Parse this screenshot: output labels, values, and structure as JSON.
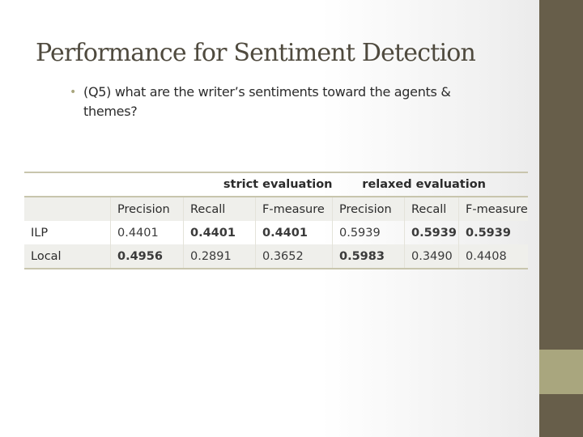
{
  "slide": {
    "title": "Performance for Sentiment Detection",
    "bullet": {
      "icon": "bullet-dot",
      "text": "(Q5)   what are the writer’s sentiments toward the agents & themes?"
    },
    "accent_colors": {
      "sidebar_dark": "#675e4a",
      "sidebar_light": "#a9a67e",
      "title": "#4f4a3e"
    }
  },
  "table": {
    "groups": [
      "strict evaluation",
      "relaxed evaluation"
    ],
    "columns": [
      "",
      "Precision",
      "Recall",
      "F-measure",
      "Precision",
      "Recall",
      "F-measure"
    ],
    "rows": [
      {
        "label": "ILP",
        "values": [
          "0.4401",
          "0.4401",
          "0.4401",
          "0.5939",
          "0.5939",
          "0.5939"
        ],
        "bold": [
          false,
          true,
          true,
          false,
          true,
          true
        ]
      },
      {
        "label": "Local",
        "values": [
          "0.4956",
          "0.2891",
          "0.3652",
          "0.5983",
          "0.3490",
          "0.4408"
        ],
        "bold": [
          true,
          false,
          false,
          true,
          false,
          false
        ]
      }
    ]
  }
}
